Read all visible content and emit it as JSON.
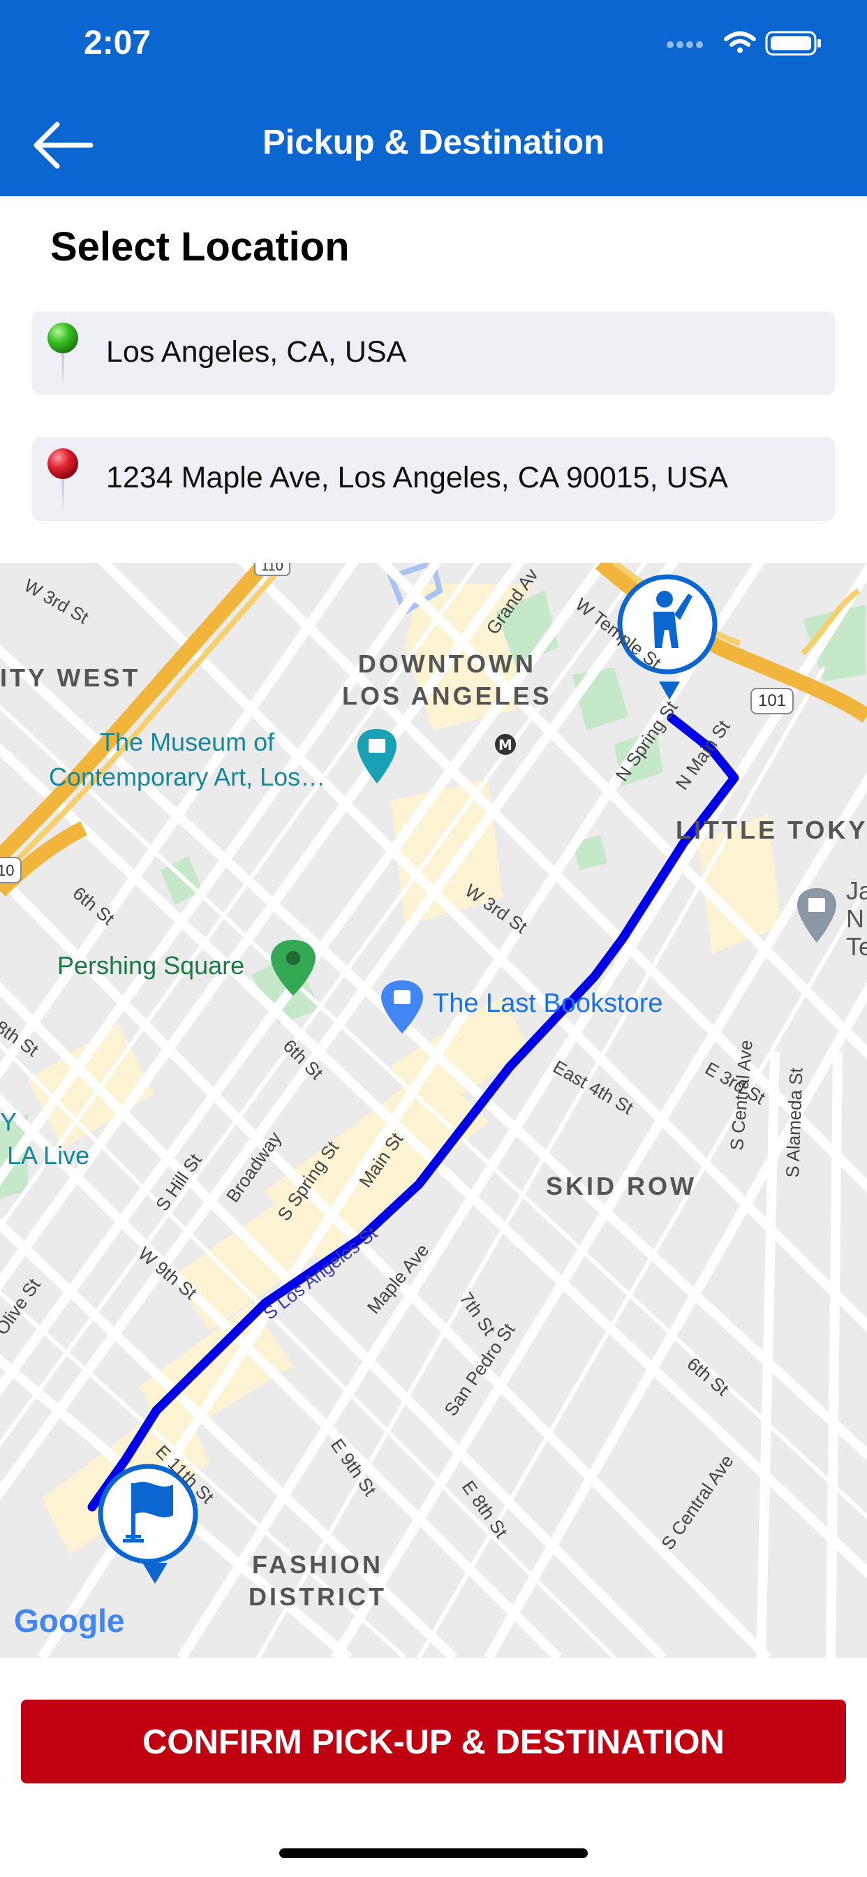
{
  "status_bar": {
    "time": "2:07",
    "icons": [
      "signal-icon",
      "wifi-icon",
      "battery-icon"
    ]
  },
  "nav": {
    "back_icon": "back-arrow-icon",
    "title": "Pickup & Destination"
  },
  "section_title": "Select Location",
  "pickup": {
    "icon": "green-pin-icon",
    "value": "Los Angeles, CA, USA"
  },
  "destination": {
    "icon": "red-pin-icon",
    "value": "1234 Maple Ave, Los Angeles, CA 90015, USA"
  },
  "map": {
    "districts": {
      "downtown": "DOWNTOWN\nLOS ANGELES",
      "city_west": "ITY WEST",
      "little_tokyo": "LITTLE TOKY",
      "skid_row": "SKID ROW",
      "fashion": "FASHION\nDISTRICT"
    },
    "pois": {
      "moca": "The Museum of\nContemporary Art, Los…",
      "pershing": "Pershing Square",
      "bookstore": "The Last Bookstore",
      "la_live": "LA Live",
      "la_live_prefix": "Y",
      "ja_partial": "Ja\nN\nTe"
    },
    "streets": {
      "w3rd_a": "W 3rd St",
      "w3rd_b": "W 3rd St",
      "grand": "Grand Av",
      "w_temple": "W Temple St",
      "n_spring": "N Spring St",
      "n_main": "N Main St",
      "s6th": "6th St",
      "s8th": "8th St",
      "sixth_b": "6th St",
      "east4th": "East 4th St",
      "e3rd": "E 3rd St",
      "s_central": "S Central Ave",
      "s_alameda": "S Alameda St",
      "s_hill": "S Hill St",
      "broadway": "Broadway",
      "s_spring": "S Spring St",
      "main": "Main St",
      "w9th": "W 9th St",
      "s_los_angeles": "S Los Angeles St",
      "maple": "Maple Ave",
      "seventh": "7th St",
      "san_pedro": "San Pedro St",
      "sixth_c": "6th St",
      "e9th": "E 9th St",
      "e8th": "E 8th St",
      "s_central_b": "S Central Ave",
      "olive": "Olive St",
      "e11th": "E 11th St",
      "hwy110": "110",
      "hwy101": "101",
      "hwy10": "10"
    },
    "metro_icon": "metro-icon",
    "markers": {
      "pickup_icon": "person-hailing-icon",
      "destination_icon": "flag-icon"
    },
    "route_color": "#0000e6",
    "logo": "Google"
  },
  "confirm_button": {
    "label": "CONFIRM PICK-UP & DESTINATION"
  },
  "colors": {
    "header": "#0b67cf",
    "button": "#c00011",
    "field": "#eff0f5"
  }
}
